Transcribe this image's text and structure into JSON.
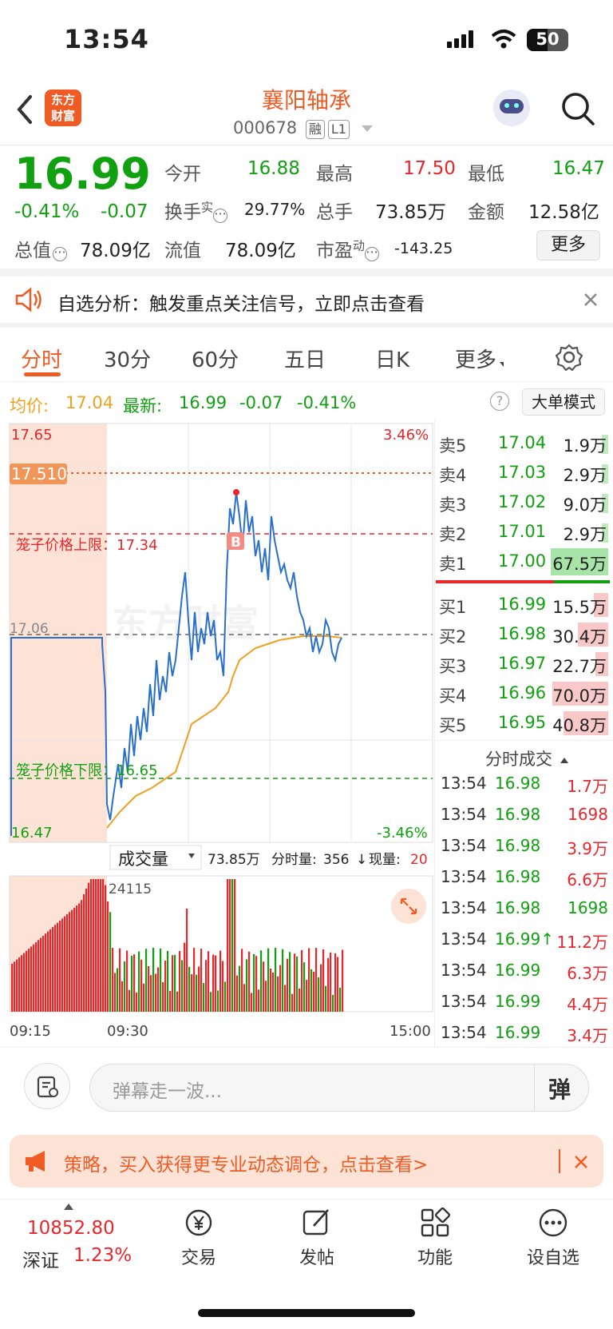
{
  "status_bar": {
    "time": "13:54",
    "battery": "50"
  },
  "header": {
    "title": "襄阳轴承",
    "code": "000678",
    "tags": [
      "融",
      "L1"
    ],
    "logo_text": [
      "东方",
      "财富"
    ]
  },
  "quote": {
    "price": "16.99",
    "change_pct": "-0.41%",
    "change": "-0.07",
    "open_label": "今开",
    "open": "16.88",
    "high_label": "最高",
    "high": "17.50",
    "low_label": "最低",
    "low": "16.47",
    "turnover_label": "换手",
    "turnover_sup": "实",
    "turnover": "29.77%",
    "volume_label": "总手",
    "volume": "73.85万",
    "amount_label": "金额",
    "amount": "12.58亿",
    "total_mv_label": "总值",
    "total_mv": "78.09亿",
    "float_mv_label": "流值",
    "float_mv": "78.09亿",
    "pe_label": "市盈",
    "pe_sup": "动",
    "pe": "-143.25",
    "more_label": "更多"
  },
  "notice": {
    "text": "自选分析：触发重点关注信号，立即点击查看"
  },
  "tabs": [
    "分时",
    "30分",
    "60分",
    "五日",
    "日K",
    "更多"
  ],
  "chart_info": {
    "avg_label": "均价:",
    "avg": "17.04",
    "latest_label": "最新:",
    "latest": "16.99",
    "latest_change": "-0.07",
    "latest_pct": "-0.41%",
    "mode_button": "大单模式"
  },
  "chart_labels": {
    "top_price": "17.65",
    "top_pct": "3.46%",
    "high_marker": "17.510",
    "cage_upper": "笼子价格上限：17.34",
    "prev_close": "17.06",
    "cage_lower": "笼子价格下限：16.65",
    "bottom_price": "16.47",
    "bottom_pct": "-3.46%",
    "buy_marker": "B",
    "watermark": "东方财富"
  },
  "volume_bar": {
    "selector": "成交量",
    "total": "73.85万",
    "tick_label": "分时量:",
    "tick_value": "356",
    "now_label": "现量:",
    "now_value": "20",
    "max_label": "24115"
  },
  "time_axis": [
    "09:15",
    "09:30",
    "15:00"
  ],
  "order_book": {
    "asks": [
      {
        "label": "卖5",
        "price": "17.04",
        "vol": "1.9万"
      },
      {
        "label": "卖4",
        "price": "17.03",
        "vol": "2.9万"
      },
      {
        "label": "卖3",
        "price": "17.02",
        "vol": "9.0万"
      },
      {
        "label": "卖2",
        "price": "17.01",
        "vol": "2.9万"
      },
      {
        "label": "卖1",
        "price": "17.00",
        "vol": "67.5万"
      }
    ],
    "bids": [
      {
        "label": "买1",
        "price": "16.99",
        "vol": "15.5万"
      },
      {
        "label": "买2",
        "price": "16.98",
        "vol": "30.4万"
      },
      {
        "label": "买3",
        "price": "16.97",
        "vol": "22.7万"
      },
      {
        "label": "买4",
        "price": "16.96",
        "vol": "70.0万"
      },
      {
        "label": "买5",
        "price": "16.95",
        "vol": "40.8万"
      }
    ]
  },
  "trades": {
    "title": "分时成交",
    "rows": [
      {
        "time": "13:54",
        "price": "16.98",
        "vol": "1.7万"
      },
      {
        "time": "13:54",
        "price": "16.98",
        "vol": "1698"
      },
      {
        "time": "13:54",
        "price": "16.98",
        "vol": "3.9万"
      },
      {
        "time": "13:54",
        "price": "16.98",
        "vol": "6.6万"
      },
      {
        "time": "13:54",
        "price": "16.98",
        "vol": "1698"
      },
      {
        "time": "13:54",
        "price": "16.99↑",
        "vol": "11.2万"
      },
      {
        "time": "13:54",
        "price": "16.99",
        "vol": "6.3万"
      },
      {
        "time": "13:54",
        "price": "16.99",
        "vol": "4.4万"
      },
      {
        "time": "13:54",
        "price": "16.99",
        "vol": "3.4万"
      }
    ]
  },
  "comment": {
    "placeholder": "弹幕走一波...",
    "danmu_button": "弹"
  },
  "banner": {
    "text": "策略，买入获得更专业动态调仓，点击查看>"
  },
  "bottom_nav": {
    "index_value": "10852.80",
    "index_name": "深证",
    "index_pct": "1.23%",
    "items": [
      "交易",
      "发帖",
      "功能",
      "设自选"
    ]
  },
  "colors": {
    "brand": "#f05a24",
    "up": "#e8262c",
    "down": "#10a010",
    "avg_line": "#f0a020",
    "price_line": "#2a6fc9"
  }
}
